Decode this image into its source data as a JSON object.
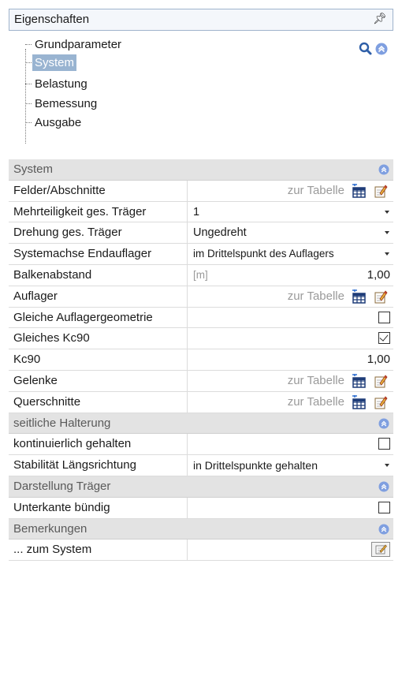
{
  "panel": {
    "title": "Eigenschaften",
    "pin_icon": "pin-icon"
  },
  "tree": {
    "items": [
      {
        "label": "Grundparameter",
        "selected": false
      },
      {
        "label": "System",
        "selected": true
      },
      {
        "label": "Belastung",
        "selected": false
      },
      {
        "label": "Bemessung",
        "selected": false
      },
      {
        "label": "Ausgabe",
        "selected": false
      }
    ]
  },
  "colors": {
    "selection": "#99b4d1",
    "category_bg": "#e3e3e3",
    "collapse_icon": "#7f9fe0"
  },
  "grid": {
    "system_cat": "System",
    "felder_name": "Felder/Abschnitte",
    "felder_link": "zur Tabelle",
    "mehrteil_name": "Mehrteiligkeit ges. Träger",
    "mehrteil_val": "1",
    "drehung_name": "Drehung ges. Träger",
    "drehung_val": "Ungedreht",
    "sysachse_name": "Systemachse Endauflager",
    "sysachse_val": "im Drittelspunkt des Auflagers",
    "balken_name": "Balkenabstand",
    "balken_unit": "[m]",
    "balken_val": "1,00",
    "auflager_name": "Auflager",
    "auflager_link": "zur Tabelle",
    "gleich_auf_name": "Gleiche Auflagergeometrie",
    "gleich_auf_checked": false,
    "gleich_kc_name": "Gleiches Kc90",
    "gleich_kc_checked": true,
    "kc_name": "Kc90",
    "kc_val": "1,00",
    "gelenke_name": "Gelenke",
    "gelenke_link": "zur Tabelle",
    "quer_name": "Querschnitte",
    "quer_link": "zur Tabelle",
    "seit_cat": "seitliche Halterung",
    "kont_name": "kontinuierlich gehalten",
    "kont_checked": false,
    "stab_name": "Stabilität Längsrichtung",
    "stab_val": "in Drittelspunkte gehalten",
    "darst_cat": "Darstellung Träger",
    "unter_name": "Unterkante bündig",
    "unter_checked": false,
    "bem_cat": "Bemerkungen",
    "zum_name": "... zum System"
  }
}
